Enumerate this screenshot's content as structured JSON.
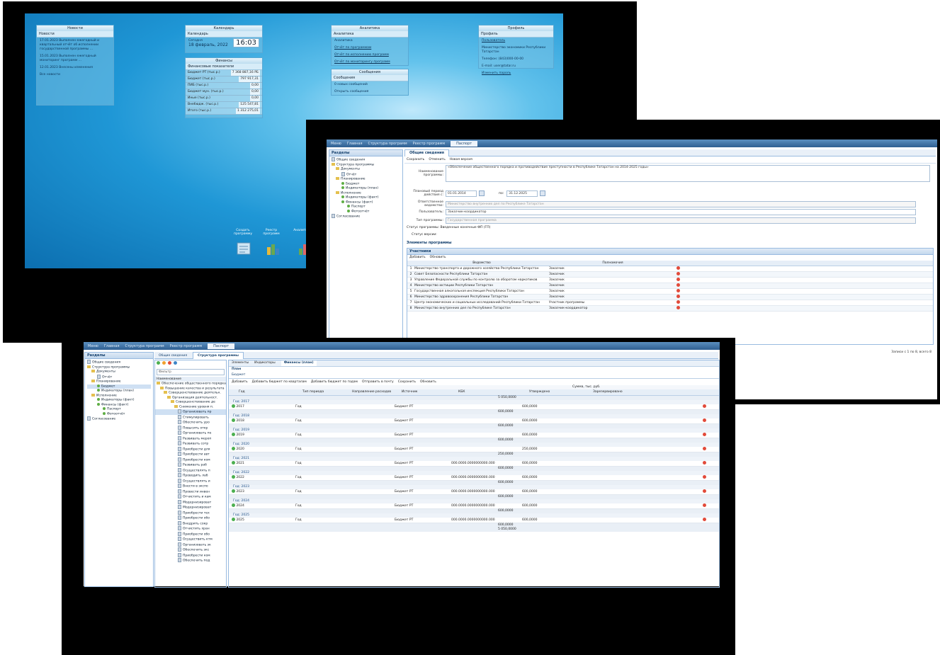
{
  "screen1": {
    "widgets": {
      "news": {
        "title": "Новости",
        "section": "Новости",
        "items": [
          "17.01.2023 Выполнен ежегодный и квартальный отчёт об исполнении государственной программы ...",
          "15.01.2023 Выполнен ежегодный мониторинг программ ...",
          "12.01.2023 Внесены изменения",
          "Все новости"
        ]
      },
      "calendar": {
        "title": "Календарь",
        "section": "Календарь",
        "date_label": "Сегодня",
        "date": "18 февраль, 2022",
        "time": "16:03"
      },
      "finance": {
        "title": "Финансы",
        "section": "Финансовые показатели",
        "rows": [
          {
            "label": "Бюджет РТ (тыс.р.)",
            "value": "7 368 887,16 РБ"
          },
          {
            "label": "Бюджет (тыс.р.)",
            "value": "797 917,31"
          },
          {
            "label": "ПИБ (тыс.р.)",
            "value": "0,00"
          },
          {
            "label": "Бюджет мун. (тыс.р.)",
            "value": "0,00"
          },
          {
            "label": "Иные (тыс.р.)",
            "value": "0,00"
          },
          {
            "label": "Внебюдж. (тыс.р.)",
            "value": "125 547,81"
          },
          {
            "label": "Итого (тыс.р.)",
            "value": "1 312 275,01"
          }
        ]
      },
      "analytics": {
        "title": "Аналитика",
        "section": "Аналитика",
        "links": [
          "Аналитика",
          "Отчёт по программам",
          "Отчёт по исполнению программ",
          "Отчёт по мониторингу программ"
        ]
      },
      "messages": {
        "title": "Сообщения",
        "section": "Сообщения",
        "items": [
          "0 новых сообщений",
          "Открыть сообщения"
        ]
      },
      "profile": {
        "title": "Профиль",
        "section": "Профиль",
        "lines": [
          "Пользователь",
          "Министерство экономики Республики Татарстан",
          "Телефон: (843)000-00-00",
          "E-mail: user@tatar.ru",
          "Изменить пароль"
        ]
      }
    },
    "dock": [
      {
        "label": "Создать программу"
      },
      {
        "label": "Реестр программ"
      },
      {
        "label": "Аналитика"
      }
    ]
  },
  "screen2": {
    "tabs": [
      "Меню",
      "Главная",
      "Структура программ",
      "Реестр программ",
      "Паспорт"
    ],
    "sidebar_title": "Разделы",
    "tree": [
      "Общие сведения",
      "Структура программы",
      "Документы",
      "Отчёт",
      "Планирование",
      "Бюджет",
      "Индикаторы (план)",
      "Исполнение",
      "Индикаторы (факт)",
      "Финансы (факт)",
      "Паспорт",
      "Фотоотчёт",
      "Согласование"
    ],
    "content_tab": "Общие сведения",
    "toolbar": [
      "Сохранить",
      "Отменить",
      "Новая версия"
    ],
    "fields": {
      "name_label": "Наименование программы:",
      "name_value": "«Обеспечение общественного порядка и противодействие преступности в Республике Татарстан на 2014-2025 годы»",
      "period_label": "Плановый период действия с:",
      "period_from": "01.01.2014",
      "period_to_label": "по:",
      "period_to": "31.12.2025",
      "dept_label": "Ответственное ведомство:",
      "dept_value": "Министерство внутренних дел по Республике Татарстан",
      "user_label": "Пользователь:",
      "user_value": "Заказчик-координатор",
      "type_label": "Тип программы:",
      "type_value": "Государственная программа",
      "status_label": "Статус программы:",
      "status_value": "Введенные конечные ФП (ГП)",
      "version_label": "Статус версии:",
      "version_value": ""
    },
    "sections": [
      "Элементы программы",
      "Участники"
    ],
    "participants_toolbar": [
      "Добавить",
      "Обновить"
    ],
    "table_headers": [
      "Ведомство",
      "Полномочия"
    ],
    "participants": [
      {
        "n": "1",
        "dept": "Министерство транспорта и дорожного хозяйства Республики Татарстан",
        "role": "Заказчик"
      },
      {
        "n": "2",
        "dept": "Совет Безопасности Республики Татарстан",
        "role": "Заказчик"
      },
      {
        "n": "3",
        "dept": "Управление Федеральной службы по контролю за оборотом наркотиков",
        "role": "Заказчик"
      },
      {
        "n": "4",
        "dept": "Министерство юстиции Республики Татарстан",
        "role": "Заказчик"
      },
      {
        "n": "5",
        "dept": "Государственная алкогольная инспекция Республики Татарстан",
        "role": "Заказчик"
      },
      {
        "n": "6",
        "dept": "Министерство здравоохранения Республики Татарстан",
        "role": "Заказчик"
      },
      {
        "n": "7",
        "dept": "Центр экономических и социальных исследований Республики Татарстан",
        "role": "Участник программы"
      },
      {
        "n": "8",
        "dept": "Министерство внутренних дел по Республике Татарстан",
        "role": "Заказчик-координатор"
      }
    ],
    "pager": "Записи с 1 по 8, всего 8"
  },
  "screen3": {
    "tabs": [
      "Меню",
      "Главная",
      "Структура программ",
      "Реестр программ",
      "Паспорт"
    ],
    "sidebar_title": "Разделы",
    "tree": [
      "Общие сведения",
      "Структура программы",
      "Документы",
      "Отчёт",
      "Планирование",
      "Бюджет",
      "Индикаторы (план)",
      "Исполнение",
      "Индикаторы (факт)",
      "Финансы (факт)",
      "Паспорт",
      "Фотоотчёт",
      "Согласование"
    ],
    "content_tabs": [
      "Общие сведения",
      "Структура программы"
    ],
    "mid_title": "Структура программы",
    "mid_filter": "Фильтр",
    "mid_header": "Наименование",
    "mid_nodes": [
      "Обеспечение общественного порядка",
      "Повышение качества и результата",
      "Совершенствование деятельн.",
      "Организация деятельност.",
      "Совершенствование де",
      "Снижение уровня п.",
      "Организовать пр",
      "Стимулировать",
      "Обеспечить уро",
      "Повысить откр",
      "Организовать пе",
      "Развивать мероп",
      "Развивать сотр",
      "Приобрести для",
      "Приобрести авт",
      "Приобрести ком",
      "Развивать раб",
      "Осуществлять п",
      "Проводить лаб",
      "Осуществлять и",
      "Внести в экспо",
      "Провести инвен",
      "Отчистить и кам",
      "Модернизироват",
      "Модернизироват",
      "Приобрести тех",
      "Приобрести обо",
      "Внедрить сокр",
      "Отчистить хран",
      "Приобрести обо",
      "Осуществить ктм",
      "Организовать эк",
      "Обеспечить экс",
      "Приобрести ком",
      "Обеспечить под"
    ],
    "sub_tabs": [
      "Элементы",
      "Индикаторы",
      "Финансы (план)"
    ],
    "sub_tab2": "План",
    "sub_tab3": "Бюджет",
    "toolbar": [
      "Добавить",
      "Добавить бюджет по кварталам",
      "Добавить бюджет по годам",
      "Отправить в почту",
      "Сохранить",
      "Обновить"
    ],
    "sum_header": "Сумма, тыс. руб.",
    "headers": [
      "Год",
      "Тип периода",
      "Направление расходов",
      "Источник",
      "КБК",
      "Утверждено",
      "Зарезервировано"
    ],
    "groups": [
      {
        "title": "Год: 2017",
        "year": "2017",
        "period": "Год",
        "source": "Бюджет РТ",
        "kbk": "",
        "value": "600,0000",
        "total": "600,0000"
      },
      {
        "title": "Год: 2018",
        "year": "2018",
        "period": "Год",
        "source": "Бюджет РТ",
        "kbk": "",
        "value": "600,0000",
        "total": "600,0000"
      },
      {
        "title": "Год: 2019",
        "year": "2019",
        "period": "Год",
        "source": "Бюджет РТ",
        "kbk": "",
        "value": "600,0000",
        "total": "600,0000"
      },
      {
        "title": "Год: 2020",
        "year": "2020",
        "period": "Год",
        "source": "Бюджет РТ",
        "kbk": "",
        "value": "250,0000",
        "total": "250,0000"
      },
      {
        "title": "Год: 2021",
        "year": "2021",
        "period": "Год",
        "source": "Бюджет РТ",
        "kbk": "000.0000.0000000000.000",
        "value": "600,0000",
        "total": "600,0000"
      },
      {
        "title": "Год: 2022",
        "year": "2022",
        "period": "Год",
        "source": "Бюджет РТ",
        "kbk": "000.0000.0000000000.000",
        "value": "600,0000",
        "total": "600,0000"
      },
      {
        "title": "Год: 2023",
        "year": "2023",
        "period": "Год",
        "source": "Бюджет РТ",
        "kbk": "000.0000.0000000000.000",
        "value": "600,0000",
        "total": "600,0000"
      },
      {
        "title": "Год: 2024",
        "year": "2024",
        "period": "Год",
        "source": "Бюджет РТ",
        "kbk": "000.0000.0000000000.000",
        "value": "600,0000",
        "total": "600,0000"
      },
      {
        "title": "Год: 2025",
        "year": "2025",
        "period": "Год",
        "source": "Бюджет РТ",
        "kbk": "000.0000.0000000000.000",
        "value": "600,0000",
        "total": "600,0000"
      }
    ],
    "grand_total": "5 050,0000",
    "grand_total_2": "5 050,0000"
  },
  "colors": {
    "desktop": "#1f97d6",
    "header": "#2f5f92",
    "add": "#4caf50",
    "delete": "#e24a3a"
  }
}
